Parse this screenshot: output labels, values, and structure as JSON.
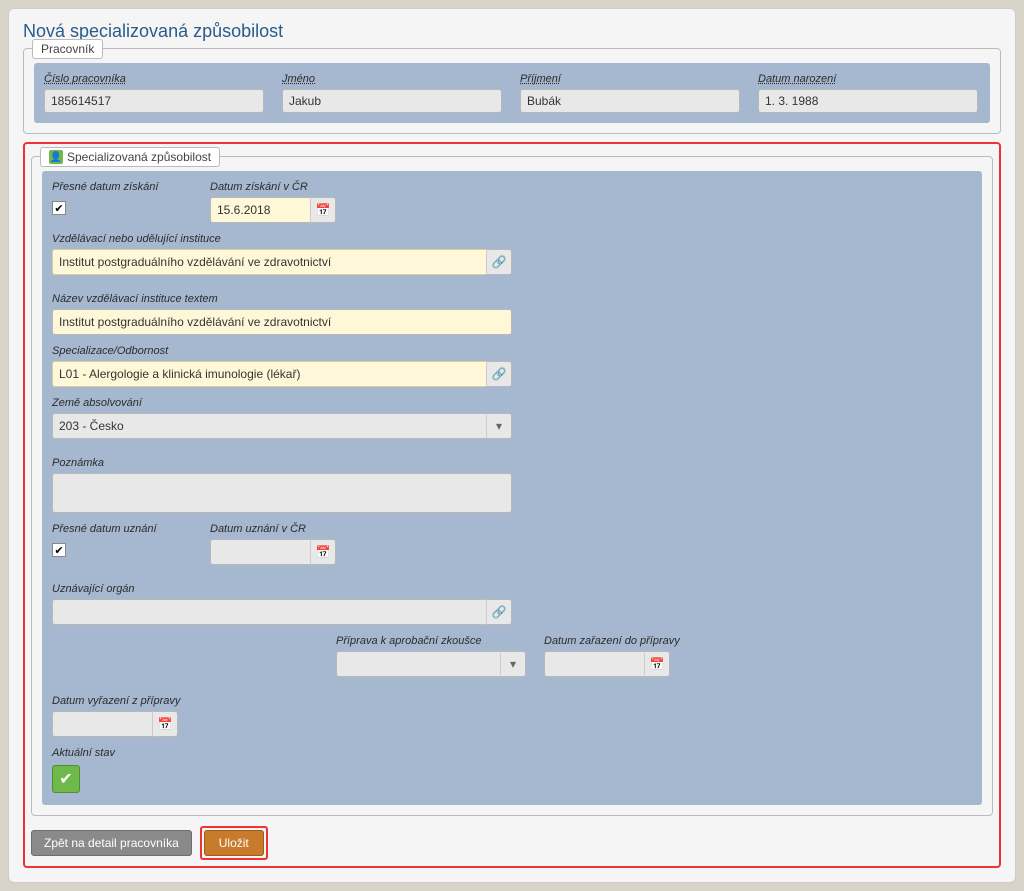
{
  "page_title": "Nová specializovaná způsobilost",
  "pracovnik": {
    "legend": "Pracovník",
    "cislo_label": "Číslo pracovníka",
    "cislo_value": "185614517",
    "jmeno_label": "Jméno",
    "jmeno_value": "Jakub",
    "prijmeni_label": "Příjmení",
    "prijmeni_value": "Bubák",
    "narozeni_label": "Datum narození",
    "narozeni_value": "1. 3. 1988"
  },
  "spec": {
    "legend": "Specializovaná způsobilost",
    "presne_ziskani_label": "Přesné datum získání",
    "presne_ziskani_checked": "✔",
    "datum_ziskani_label": "Datum získání v ČR",
    "datum_ziskani_value": "15.6.2018",
    "instituce_label": "Vzdělávací nebo udělující instituce",
    "instituce_value": "Institut postgraduálního vzdělávání ve zdravotnictví",
    "nazev_text_label": "Název vzdělávací instituce textem",
    "nazev_text_value": "Institut postgraduálního vzdělávání ve zdravotnictví",
    "specializace_label": "Specializace/Odbornost",
    "specializace_value": "L01 - Alergologie a klinická imunologie (lékař)",
    "zeme_label": "Země absolvování",
    "zeme_value": "203 - Česko",
    "poznamka_label": "Poznámka",
    "poznamka_value": "",
    "presne_uznani_label": "Přesné datum uznání",
    "presne_uznani_checked": "✔",
    "datum_uznani_label": "Datum uznání v ČR",
    "datum_uznani_value": "",
    "uznavajici_label": "Uznávající orgán",
    "uznavajici_value": "",
    "priprava_label": "Příprava k aprobační zkoušce",
    "priprava_value": "",
    "datum_zarazeni_label": "Datum zařazení do přípravy",
    "datum_zarazeni_value": "",
    "datum_vyrazeni_label": "Datum vyřazení z přípravy",
    "datum_vyrazeni_value": "",
    "aktualni_stav_label": "Aktuální stav"
  },
  "buttons": {
    "back": "Zpět na detail pracovníka",
    "save": "Uložit"
  }
}
